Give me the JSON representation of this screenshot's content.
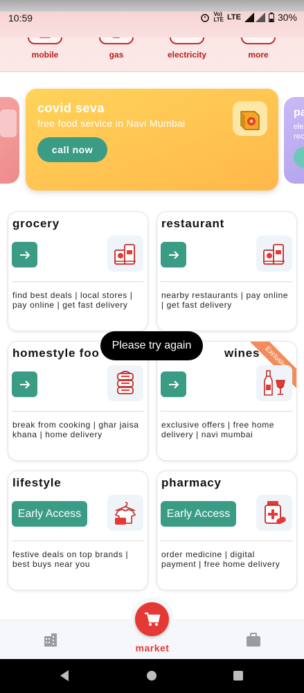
{
  "status_bar": {
    "time": "10:59",
    "network_top": "Vo)",
    "network_bottom": "LTE",
    "lte": "LTE",
    "battery": "30%"
  },
  "services": [
    {
      "label": "mobile",
      "icon": "mobile-phone-icon"
    },
    {
      "label": "gas",
      "icon": "gas-cylinder-icon"
    },
    {
      "label": "electricity",
      "icon": "light-bulb-icon"
    },
    {
      "label": "more",
      "icon": "arrow-right-icon"
    }
  ],
  "banners": {
    "main": {
      "title": "covid seva",
      "subtitle": "free food service in Navi Mumbai",
      "button": "call now",
      "icon": "food-packet-icon"
    },
    "right": {
      "title": "pa",
      "subtitle_line1": "ele",
      "subtitle_line2": "rec"
    }
  },
  "cards": [
    {
      "title": "grocery",
      "icon": "grocery-bag-icon",
      "description": "find best deals | local stores | pay online | get fast delivery"
    },
    {
      "title": "restaurant",
      "icon": "restaurant-bag-icon",
      "description": "nearby restaurants | pay online | get fast delivery"
    },
    {
      "title": "homestyle foo",
      "icon": "tiffin-box-icon",
      "description": "break from cooking | ghar jaisa khana | home delivery"
    },
    {
      "title": "wines",
      "icon": "wine-bottle-icon",
      "description": "exclusive offers | free home delivery | navi mumbai",
      "ribbon": "Exclusive"
    },
    {
      "title": "lifestyle",
      "icon": "clothes-hanger-icon",
      "button": "Early Access",
      "description": "festive deals on top brands | best buys near you"
    },
    {
      "title": "pharmacy",
      "icon": "medicine-icon",
      "button": "Early Access",
      "description": "order medicine | digital payment | free home delivery"
    }
  ],
  "toast": "Please try again",
  "bottom_nav": {
    "center_label": "market",
    "left_icon": "building-icon",
    "right_icon": "briefcase-icon",
    "center_icon": "cart-icon"
  },
  "colors": {
    "accent_green": "#3b9c86",
    "brand_red": "#e53935",
    "banner_yellow": "#ffc850"
  }
}
